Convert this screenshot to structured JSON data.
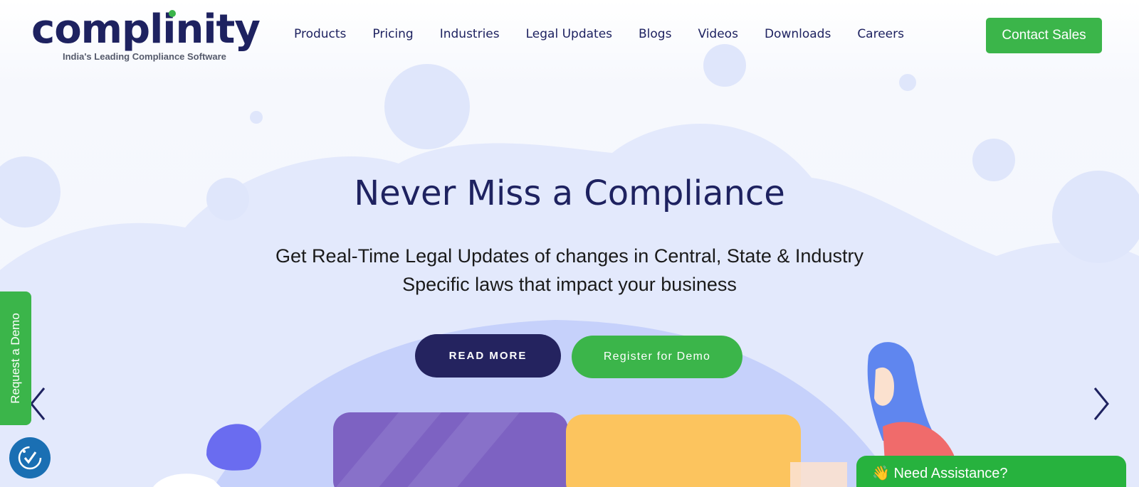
{
  "logo": {
    "wordmark": "complinity",
    "tagline": "India's Leading Compliance Software"
  },
  "nav": {
    "items": [
      "Products",
      "Pricing",
      "Industries",
      "Legal Updates",
      "Blogs",
      "Videos",
      "Downloads",
      "Careers"
    ],
    "contact_label": "Contact Sales"
  },
  "hero": {
    "title": "Never Miss a Compliance",
    "subtitle_line1": "Get Real-Time Legal Updates of changes in Central, State & Industry",
    "subtitle_line2": "Specific laws that impact your business",
    "read_more_label": "READ MORE",
    "register_label": "Register for Demo"
  },
  "side": {
    "request_demo_label": "Request a Demo"
  },
  "chat": {
    "label": "👋 Need Assistance?"
  },
  "colors": {
    "navy": "#1e2260",
    "green": "#3bb54a",
    "bubble": "#dfe6fb",
    "hill": "#c6d1fb"
  },
  "icons": {
    "prev": "chevron-left-icon",
    "next": "chevron-right-icon",
    "accessibility": "accessibility-icon"
  }
}
